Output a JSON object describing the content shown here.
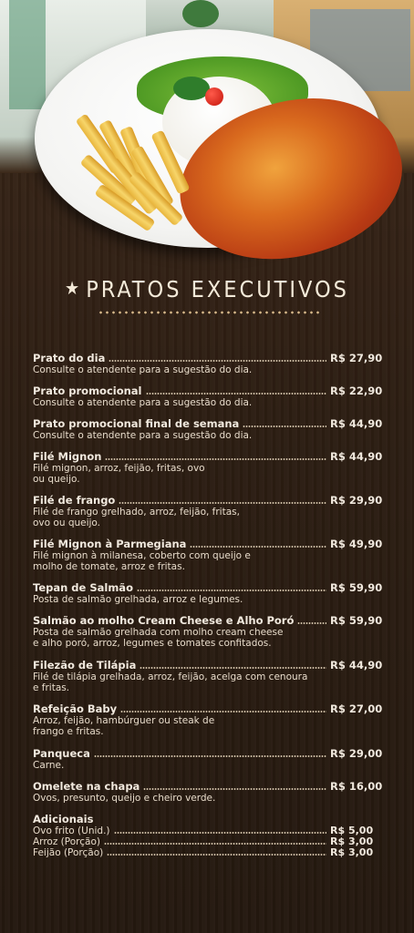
{
  "header": {
    "title": "PRATOS EXECUTIVOS",
    "star_icon": "star-icon"
  },
  "items": [
    {
      "name": "Prato do dia",
      "price": "R$ 27,90",
      "desc": [
        "Consulte o atendente para a sugestão do dia."
      ]
    },
    {
      "name": "Prato promocional",
      "price": "R$ 22,90",
      "desc": [
        "Consulte o atendente para a sugestão do dia."
      ]
    },
    {
      "name": "Prato promocional final de semana",
      "price": "R$ 44,90",
      "desc": [
        "Consulte o atendente para a sugestão do dia."
      ]
    },
    {
      "name": "Filé Mignon",
      "price": "R$ 44,90",
      "desc": [
        "Filé mignon, arroz, feijão, fritas, ovo",
        "ou queijo."
      ]
    },
    {
      "name": "Filé de frango",
      "price": "R$ 29,90",
      "desc": [
        "Filé de frango grelhado,  arroz, feijão, fritas,",
        "ovo ou queijo."
      ]
    },
    {
      "name": "Filé Mignon à Parmegiana",
      "price": "R$ 49,90",
      "desc": [
        "Filé mignon à milanesa, coberto com queijo e",
        "molho de tomate, arroz e fritas."
      ]
    },
    {
      "name": "Tepan de Salmão",
      "price": "R$ 59,90",
      "desc": [
        "Posta de salmão grelhada, arroz e legumes."
      ]
    },
    {
      "name": "Salmão ao molho Cream Cheese e Alho Poró",
      "price": "R$ 59,90",
      "desc": [
        "Posta de salmão grelhada com molho cream cheese",
        "e alho poró, arroz, legumes e tomates confitados."
      ]
    },
    {
      "name": "Filezão de Tilápia",
      "price": "R$ 44,90",
      "desc": [
        "Filé de tilápia grelhada, arroz, feijão, acelga com cenoura",
        "e fritas."
      ]
    },
    {
      "name": "Refeição Baby",
      "price": "R$ 27,00",
      "desc": [
        "Arroz, feijão, hambúrguer ou steak de",
        "frango e fritas."
      ]
    },
    {
      "name": "Panqueca",
      "price": "R$ 29,00",
      "desc": [
        "Carne."
      ]
    },
    {
      "name": "Omelete na chapa",
      "price": "R$ 16,00",
      "desc": [
        "Ovos, presunto, queijo e cheiro verde."
      ]
    }
  ],
  "extras": {
    "title": "Adicionais",
    "items": [
      {
        "name": "Ovo frito (Unid.)",
        "price": "R$ 5,00"
      },
      {
        "name": "Arroz (Porção)",
        "price": "R$ 3,00"
      },
      {
        "name": "Feijão (Porção)",
        "price": "R$ 3,00"
      }
    ]
  }
}
